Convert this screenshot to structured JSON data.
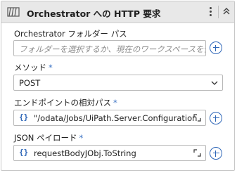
{
  "header": {
    "title": "Orchestrator への HTTP 要求",
    "icon": "http-request-icon"
  },
  "folder": {
    "label": "Orchestrator フォルダー パス",
    "placeholder": "フォルダーを選択するか、現在のワークスペースを使用するには空白のままにします"
  },
  "method": {
    "label": "メソッド",
    "required_mark": "*",
    "value": "POST"
  },
  "endpoint": {
    "label": "エンドポイントの相対パス",
    "required_mark": "*",
    "value": "\"/odata/Jobs/UiPath.Server.Configuration"
  },
  "json_payload": {
    "label": "JSON ペイロード",
    "required_mark": "*",
    "value": "requestBodyJObj.ToString"
  },
  "colors": {
    "accent": "#2f67b8",
    "header_bg": "#e8e8e8",
    "border": "#b9b9b9"
  }
}
